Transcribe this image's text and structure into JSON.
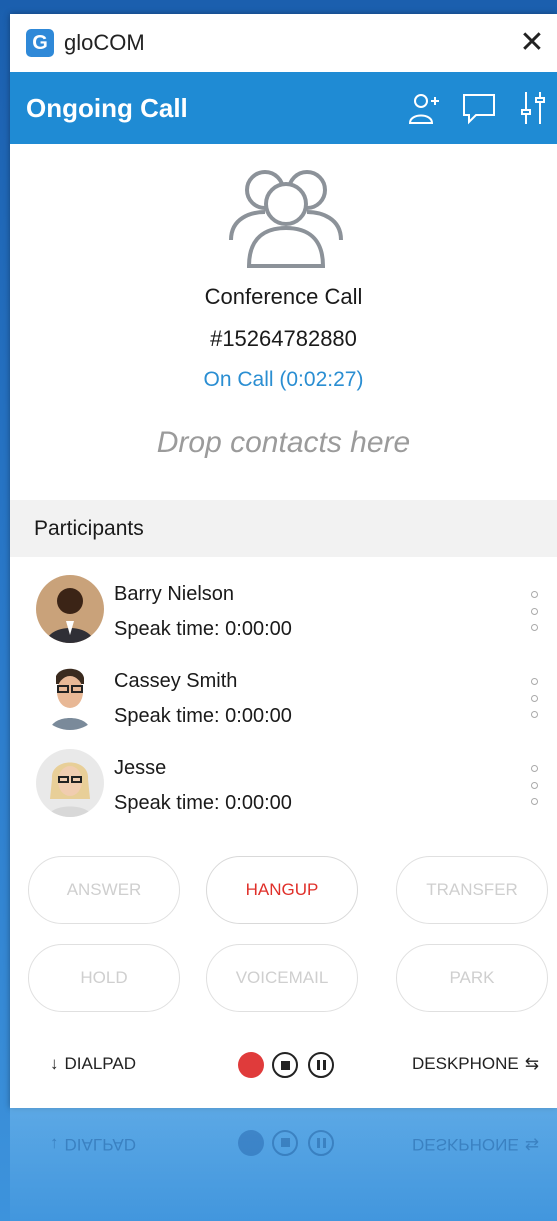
{
  "window": {
    "app_title": "gloCOM",
    "close_glyph": "✕"
  },
  "header": {
    "title": "Ongoing Call",
    "icons": [
      "add-participant-icon",
      "chat-icon",
      "settings-sliders-icon"
    ]
  },
  "call": {
    "name": "Conference Call",
    "number": "#15264782880",
    "status": "On Call (0:02:27)",
    "drop_hint": "Drop contacts here"
  },
  "participants": {
    "header": "Participants",
    "items": [
      {
        "name": "Barry Nielson",
        "speak_time": "Speak time: 0:00:00"
      },
      {
        "name": "Cassey Smith",
        "speak_time": "Speak time: 0:00:00"
      },
      {
        "name": "Jesse",
        "speak_time": "Speak time: 0:00:00"
      }
    ]
  },
  "actions": {
    "answer": "ANSWER",
    "hangup": "HANGUP",
    "transfer": "TRANSFER",
    "hold": "HOLD",
    "voicemail": "VOICEMAIL",
    "park": "PARK"
  },
  "bottom": {
    "dialpad": "DIALPAD",
    "deskphone": "DESKPHONE"
  },
  "colors": {
    "accent": "#1f8bd4",
    "status_text": "#2a8ed2",
    "hangup": "#e0302a",
    "record": "#e03b3b"
  }
}
